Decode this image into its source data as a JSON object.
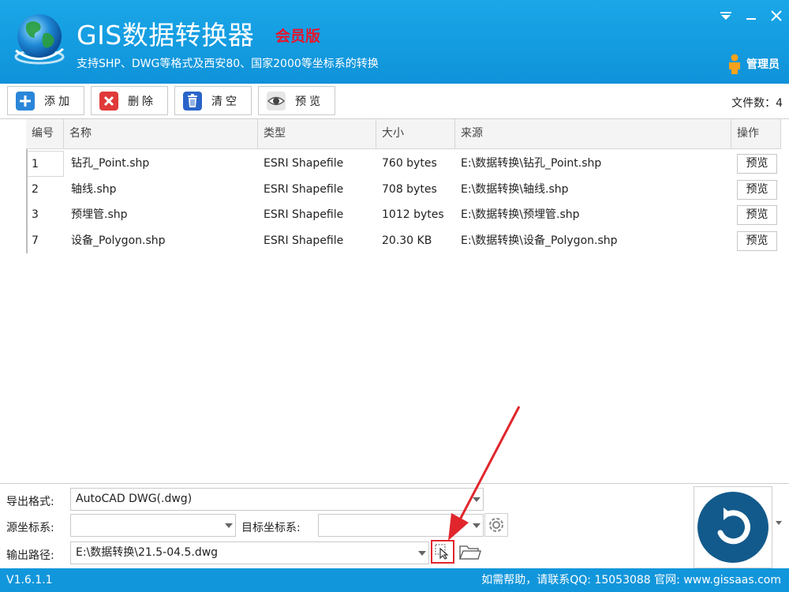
{
  "header": {
    "title": "GIS数据转换器",
    "edition": "会员版",
    "subtitle": "支持SHP、DWG等格式及西安80、国家2000等坐标系的转换",
    "user": "管理员",
    "icons": [
      "globe-icon",
      "dropdown-menu-icon",
      "minimize-icon",
      "close-icon",
      "user-icon"
    ]
  },
  "toolbar": {
    "add_label": "添加",
    "delete_label": "删除",
    "clear_label": "清空",
    "preview_label": "预览",
    "file_count": "文件数：4"
  },
  "table": {
    "columns": [
      "编号",
      "名称",
      "类型",
      "大小",
      "来源",
      "操作"
    ],
    "rows": [
      {
        "id": "1",
        "name": "钻孔_Point.shp",
        "type": "ESRI Shapefile",
        "size": "760 bytes",
        "source": "E:\\数据转换\\钻孔_Point.shp",
        "action": "预览"
      },
      {
        "id": "2",
        "name": "轴线.shp",
        "type": "ESRI Shapefile",
        "size": "708 bytes",
        "source": "E:\\数据转换\\轴线.shp",
        "action": "预览"
      },
      {
        "id": "3",
        "name": "预埋管.shp",
        "type": "ESRI Shapefile",
        "size": "1012 bytes",
        "source": "E:\\数据转换\\预埋管.shp",
        "action": "预览"
      },
      {
        "id": "7",
        "name": "设备_Polygon.shp",
        "type": "ESRI Shapefile",
        "size": "20.30 KB",
        "source": "E:\\数据转换\\设备_Polygon.shp",
        "action": "预览"
      }
    ]
  },
  "settings": {
    "export_format_label": "导出格式:",
    "export_format_value": "AutoCAD DWG(.dwg)",
    "source_crs_label": "源坐标系:",
    "source_crs_value": "",
    "target_crs_label": "目标坐标系:",
    "target_crs_value": "",
    "output_path_label": "输出路径:",
    "output_path_value": "E:\\数据转换\\21.5-04.5.dwg"
  },
  "status": {
    "version": "V1.6.1.1",
    "help": "如需帮助，请联系QQ:   15053088   官网:   www.gissaas.com"
  },
  "colors": {
    "header_blue": "#1296db",
    "edition_red": "#e8152a",
    "convert_blue": "#135a8c",
    "highlight_red": "#e0262c"
  }
}
